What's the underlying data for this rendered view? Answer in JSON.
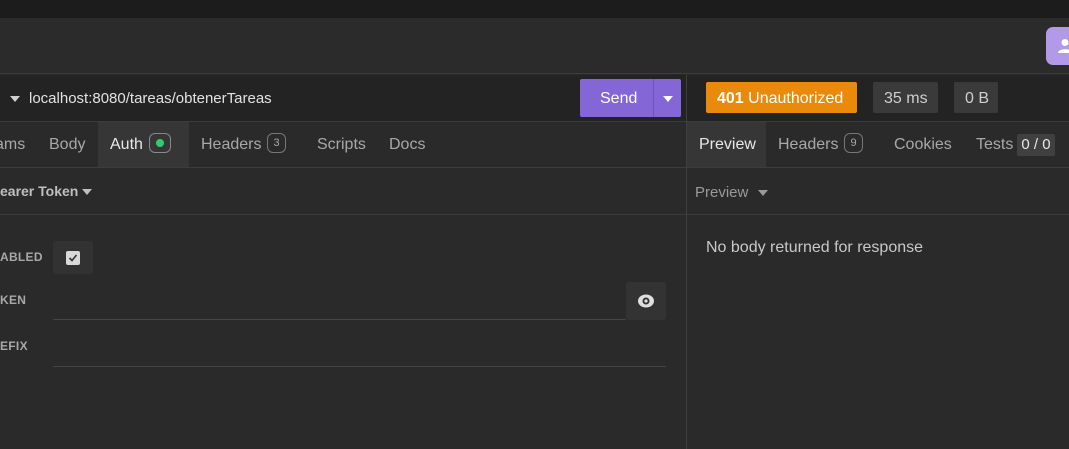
{
  "request": {
    "url": "localhost:8080/tareas/obtenerTareas",
    "send_label": "Send",
    "tabs": [
      {
        "label": "ams"
      },
      {
        "label": "Body"
      },
      {
        "label": "Auth"
      },
      {
        "label": "Headers",
        "count": "3"
      },
      {
        "label": "Scripts"
      },
      {
        "label": "Docs"
      }
    ],
    "auth": {
      "type_label": "earer Token",
      "fields": {
        "enabled_label": "ABLED",
        "token_label": "KEN",
        "prefix_label": "EFIX"
      },
      "enabled_checked": true,
      "status_color": "#2ecc71"
    }
  },
  "response": {
    "status_code": "401",
    "status_text": "Unauthorized",
    "status_color": "#e98a0a",
    "time": "35 ms",
    "size": "0 B",
    "tabs": [
      {
        "label": "Preview"
      },
      {
        "label": "Headers",
        "count": "9"
      },
      {
        "label": "Cookies"
      },
      {
        "label": "Tests",
        "count": "0 / 0"
      }
    ],
    "preview_mode": "Preview",
    "empty_message": "No body returned for response"
  },
  "colors": {
    "accent": "#8566d6",
    "profile": "#b39ae8"
  },
  "icons": [
    "user-icon",
    "chevron-down-icon",
    "check-icon",
    "eye-icon"
  ]
}
